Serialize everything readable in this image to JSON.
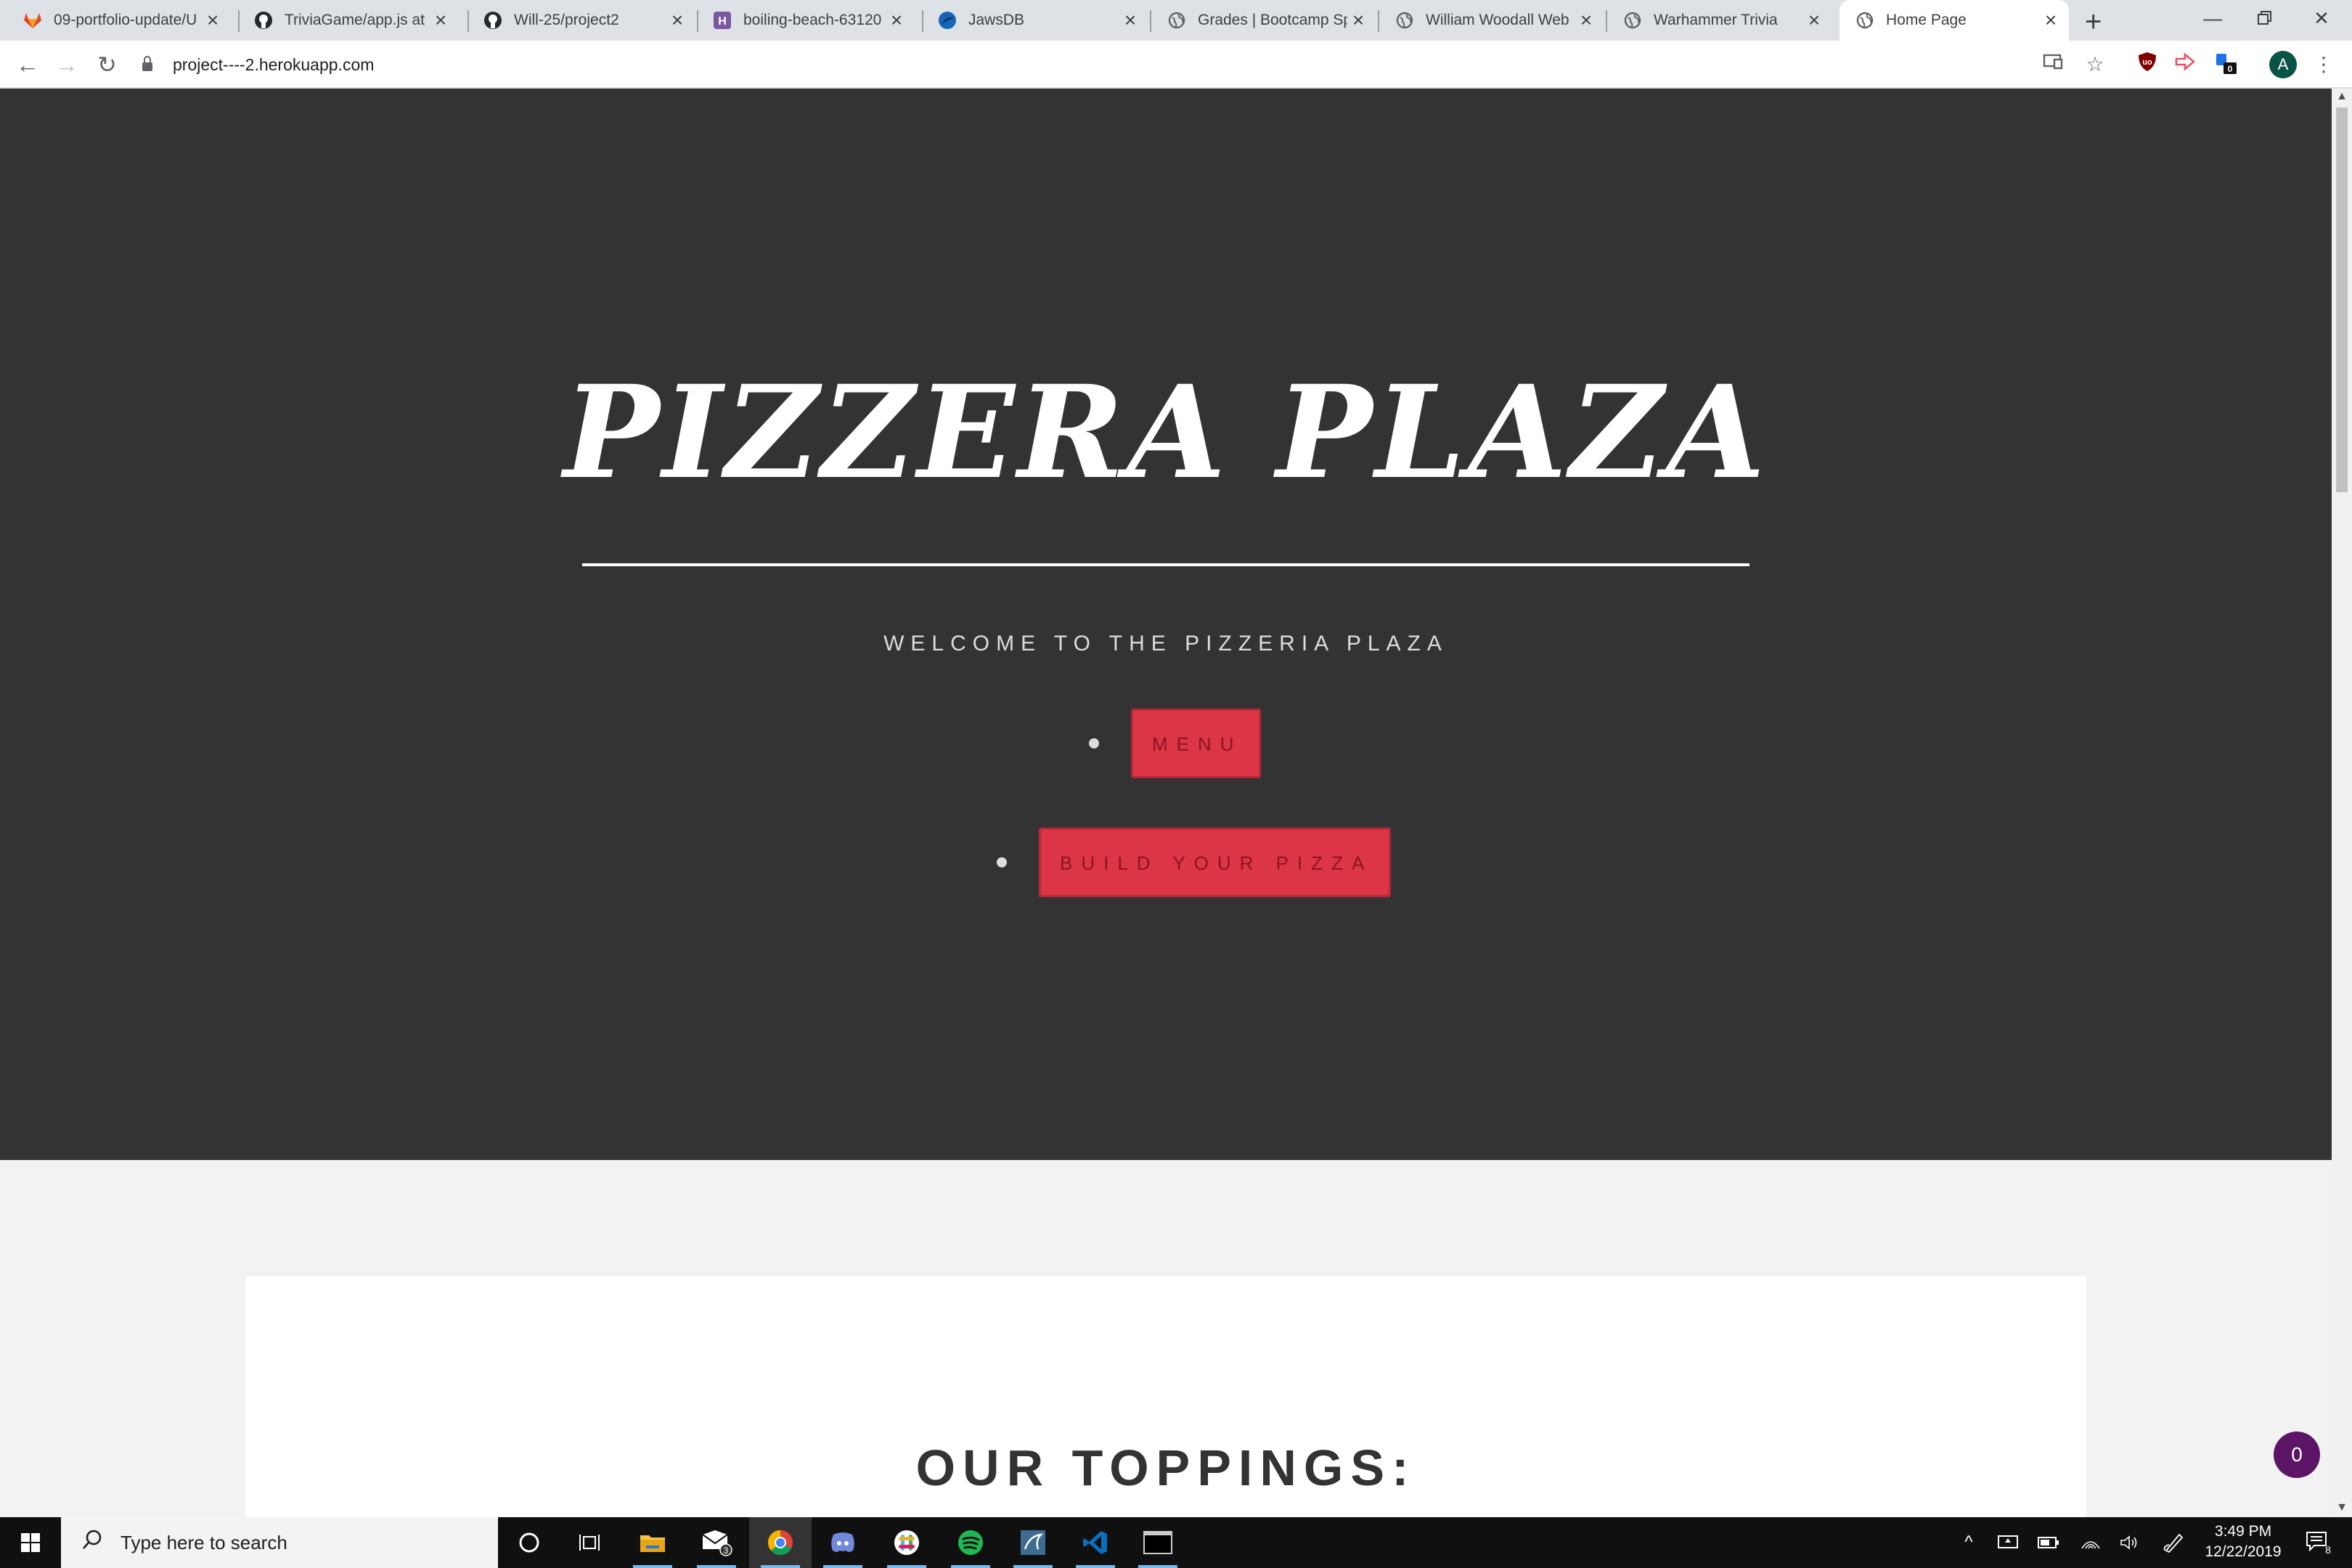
{
  "browser": {
    "tabs": [
      {
        "title": "09-portfolio-update/U",
        "icon": "gitlab-icon",
        "active": false
      },
      {
        "title": "TriviaGame/app.js at n",
        "icon": "github-icon",
        "active": false
      },
      {
        "title": "Will-25/project2",
        "icon": "github-icon",
        "active": false
      },
      {
        "title": "boiling-beach-63120",
        "icon": "heroku-icon",
        "active": false
      },
      {
        "title": "JawsDB",
        "icon": "jawsdb-icon",
        "active": false
      },
      {
        "title": "Grades | Bootcamp Sp",
        "icon": "globe-icon",
        "active": false
      },
      {
        "title": "William Woodall Web",
        "icon": "globe-icon",
        "active": false
      },
      {
        "title": "Warhammer Trivia",
        "icon": "globe-icon",
        "active": false
      },
      {
        "title": "Home Page",
        "icon": "globe-icon",
        "active": true
      }
    ],
    "url": "project----2.herokuapp.com",
    "profile_initial": "A",
    "extension_badge": "0"
  },
  "page": {
    "hero_title": "PIZZERA PLAZA",
    "hero_subtitle": "WELCOME TO THE PIZZERIA PLAZA",
    "nav": {
      "menu_label": "MENU",
      "build_label": "BUILD YOUR PIZZA"
    },
    "section_heading": "OUR TOPPINGS:",
    "chat_badge_count": "0"
  },
  "taskbar": {
    "search_placeholder": "Type here to search",
    "mail_badge": "3",
    "time": "3:49 PM",
    "date": "12/22/2019",
    "notification_count": "8"
  },
  "colors": {
    "hero_bg": "#333333",
    "button_bg": "#dc3545",
    "button_text": "#8a1522",
    "chat_badge": "#5c1566"
  }
}
